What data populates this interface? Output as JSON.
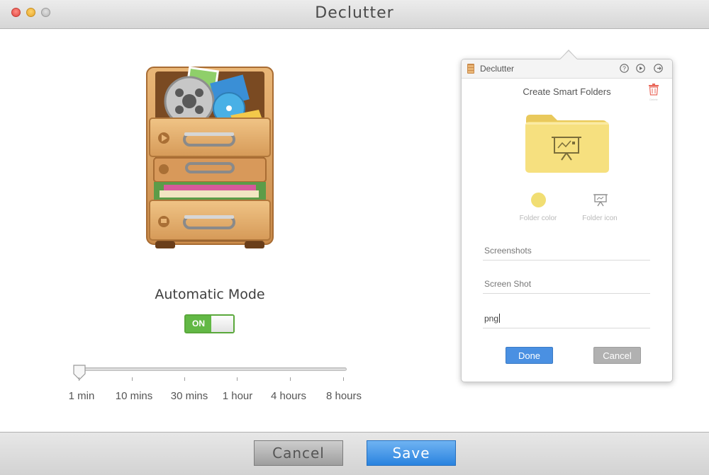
{
  "window": {
    "title": "Declutter"
  },
  "main": {
    "mode_label": "Automatic Mode",
    "toggle": {
      "label": "ON",
      "state": "on"
    },
    "interval_slider": {
      "ticks": [
        "1 min",
        "10 mins",
        "30 mins",
        "1 hour",
        "4 hours",
        "8 hours"
      ],
      "selected": "1 min"
    }
  },
  "popover": {
    "app_name": "Declutter",
    "heading": "Create Smart Folders",
    "delete_label": "Delete",
    "folder_color_label": "Folder color",
    "folder_icon_label": "Folder icon",
    "folder_color": "#f1de73",
    "fields": {
      "name": "Screenshots",
      "keyword": "Screen Shot",
      "extension": "png"
    },
    "done_label": "Done",
    "cancel_label": "Cancel",
    "header_icons": [
      "help-icon",
      "play-icon",
      "exit-icon"
    ]
  },
  "footer": {
    "cancel_label": "Cancel",
    "save_label": "Save"
  },
  "colors": {
    "accent": "#4a90e2",
    "toggle_on": "#62b845",
    "save_button": "#2a83df"
  }
}
